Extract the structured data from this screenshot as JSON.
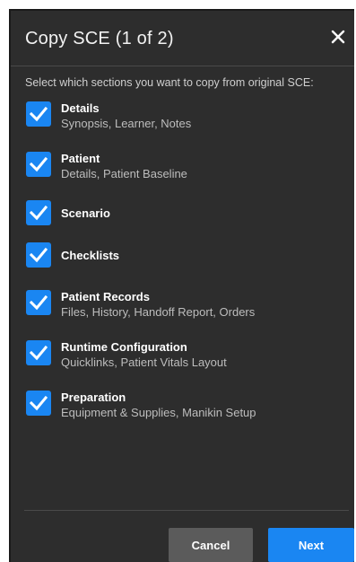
{
  "dialog": {
    "title": "Copy SCE (1 of 2)",
    "close_icon": "close-icon",
    "instruction": "Select which sections you want to copy from original SCE:"
  },
  "options": [
    {
      "title": "Details",
      "subtitle": "Synopsis, Learner, Notes",
      "checked": true
    },
    {
      "title": "Patient",
      "subtitle": "Details, Patient Baseline",
      "checked": true
    },
    {
      "title": "Scenario",
      "subtitle": "",
      "checked": true
    },
    {
      "title": "Checklists",
      "subtitle": "",
      "checked": true
    },
    {
      "title": "Patient Records",
      "subtitle": "Files, History, Handoff Report, Orders",
      "checked": true
    },
    {
      "title": "Runtime Configuration",
      "subtitle": "Quicklinks, Patient Vitals Layout",
      "checked": true
    },
    {
      "title": "Preparation",
      "subtitle": "Equipment & Supplies, Manikin Setup",
      "checked": true
    }
  ],
  "buttons": {
    "cancel": "Cancel",
    "next": "Next"
  },
  "colors": {
    "accent": "#1a86f2",
    "dialog_bg": "#2d2d2d",
    "cancel_bg": "#5b5b5b"
  }
}
